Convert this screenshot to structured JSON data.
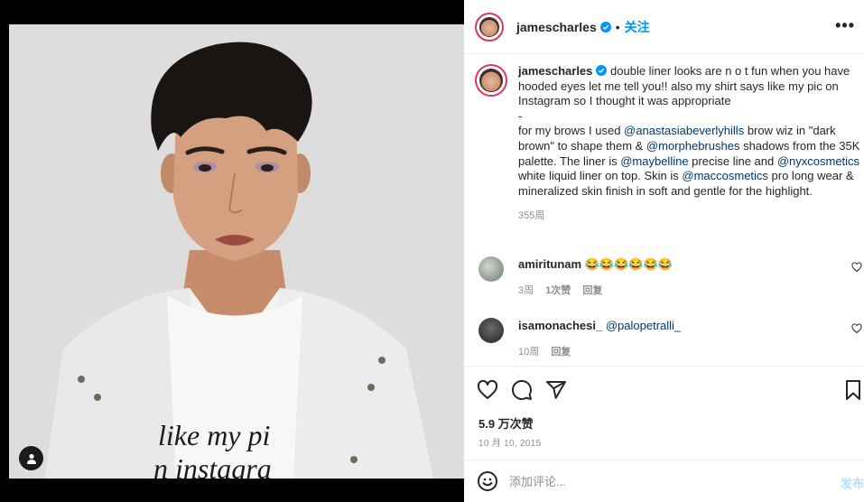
{
  "post": {
    "username": "jamescharles",
    "follow_label": "关注",
    "separator": "•",
    "more_label": "•••"
  },
  "photo": {
    "shirt_text_line1": "like my pi",
    "shirt_text_line2": "n instagra"
  },
  "caption": {
    "username": "jamescharles",
    "part1": " double liner looks are n o t fun when you have hooded eyes let me tell you!! also my shirt says like my pic on Instagram so I thought it was appropriate\n-\nfor my brows I used ",
    "mention1": "@anastasiabeverlyhills",
    "part2": " brow wiz in \"dark brown\" to shape them & ",
    "mention2": "@morphebrushes",
    "part3": " shadows from the 35K palette. The liner is ",
    "mention3": "@maybelline",
    "part4": " precise line and ",
    "mention4": "@nyxcosmetics",
    "part5": " white liquid liner on top. Skin is ",
    "mention5": "@maccosmetics",
    "part6": " pro long wear & mineralized skin finish in soft and gentle for the highlight.",
    "time": "355周"
  },
  "comments": [
    {
      "username": "amiritunam",
      "text": "😂😂😂😂😂😂",
      "time": "3周",
      "likes": "1次赞",
      "reply": "回复"
    },
    {
      "username": "isamonachesi_",
      "mention": "@palopetralli_",
      "time": "10周",
      "reply": "回复"
    }
  ],
  "actions": {
    "likes": "5.9 万次赞",
    "date": "10 月 10, 2015"
  },
  "add_comment": {
    "placeholder": "添加评论...",
    "post_label": "发布"
  },
  "colors": {
    "accent": "#0095f6",
    "mention": "#00376b",
    "muted": "#8e8e8e",
    "story_ring": "#e0355f"
  }
}
